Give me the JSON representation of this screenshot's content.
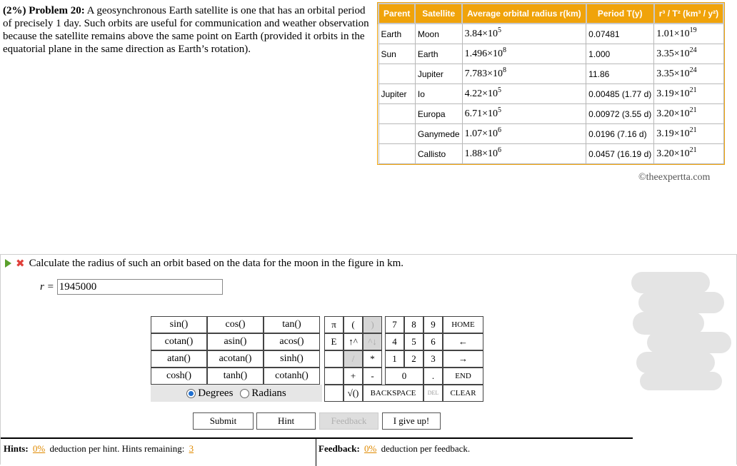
{
  "problem": {
    "label": "(2%) Problem 20:",
    "text": "A geosynchronous Earth satellite is one that has an orbital period of precisely 1 day. Such orbits are useful for communication and weather observation because the satellite remains above the same point on Earth (provided it orbits in the equatorial plane in the same direction as Earth’s rotation)."
  },
  "table": {
    "headers": [
      "Parent",
      "Satellite",
      "Average orbital radius r(km)",
      "Period T(y)",
      "r³ / T² (km³ / y²)"
    ],
    "rows": [
      {
        "parent": "Earth",
        "satellite": "Moon",
        "r_m": "3.84×10",
        "r_e": "5",
        "period": "0.07481",
        "ratio_m": "1.01×10",
        "ratio_e": "19"
      },
      {
        "parent": "Sun",
        "satellite": "Earth",
        "r_m": "1.496×10",
        "r_e": "8",
        "period": "1.000",
        "ratio_m": "3.35×10",
        "ratio_e": "24"
      },
      {
        "parent": "",
        "satellite": "Jupiter",
        "r_m": "7.783×10",
        "r_e": "8",
        "period": "11.86",
        "ratio_m": "3.35×10",
        "ratio_e": "24"
      },
      {
        "parent": "Jupiter",
        "satellite": "Io",
        "r_m": "4.22×10",
        "r_e": "5",
        "period": "0.00485 (1.77 d)",
        "ratio_m": "3.19×10",
        "ratio_e": "21"
      },
      {
        "parent": "",
        "satellite": "Europa",
        "r_m": "6.71×10",
        "r_e": "5",
        "period": "0.00972 (3.55 d)",
        "ratio_m": "3.20×10",
        "ratio_e": "21"
      },
      {
        "parent": "",
        "satellite": "Ganymede",
        "r_m": "1.07×10",
        "r_e": "6",
        "period": "0.0196 (7.16 d)",
        "ratio_m": "3.19×10",
        "ratio_e": "21"
      },
      {
        "parent": "",
        "satellite": "Callisto",
        "r_m": "1.88×10",
        "r_e": "6",
        "period": "0.0457 (16.19 d)",
        "ratio_m": "3.20×10",
        "ratio_e": "21"
      }
    ]
  },
  "copyright": "©theexpertta.com",
  "question": {
    "text": "Calculate the radius of such an orbit based on the data for the moon in the figure in km.",
    "var_label": "r =",
    "answer_value": "1945000"
  },
  "keypad": {
    "functions": [
      [
        "sin()",
        "cos()",
        "tan()"
      ],
      [
        "cotan()",
        "asin()",
        "acos()"
      ],
      [
        "atan()",
        "acotan()",
        "sinh()"
      ],
      [
        "cosh()",
        "tanh()",
        "cotanh()"
      ]
    ],
    "degrees": "Degrees",
    "radians": "Radians",
    "pi": "π",
    "lparen": "(",
    "rparen": ")",
    "k7": "7",
    "k8": "8",
    "k9": "9",
    "home": "HOME",
    "e": "E",
    "uparrow": "↑^",
    "caretdown": "^↓",
    "k4": "4",
    "k5": "5",
    "k6": "6",
    "left": "←",
    "slash": "/",
    "star": "*",
    "k1": "1",
    "k2": "2",
    "k3": "3",
    "right": "→",
    "plus": "+",
    "minus": "-",
    "k0": "0",
    "dot": ".",
    "end": "END",
    "sqrt": "√()",
    "backspace": "BACKSPACE",
    "del": "DEL",
    "clear": "CLEAR"
  },
  "buttons": {
    "submit": "Submit",
    "hint": "Hint",
    "feedback": "Feedback",
    "giveup": "I give up!"
  },
  "hints": {
    "label": "Hints:",
    "pct": "0%",
    "text": "deduction per hint. Hints remaining:",
    "remaining": "3"
  },
  "feedback": {
    "label": "Feedback:",
    "pct": "0%",
    "text": "deduction per feedback."
  }
}
